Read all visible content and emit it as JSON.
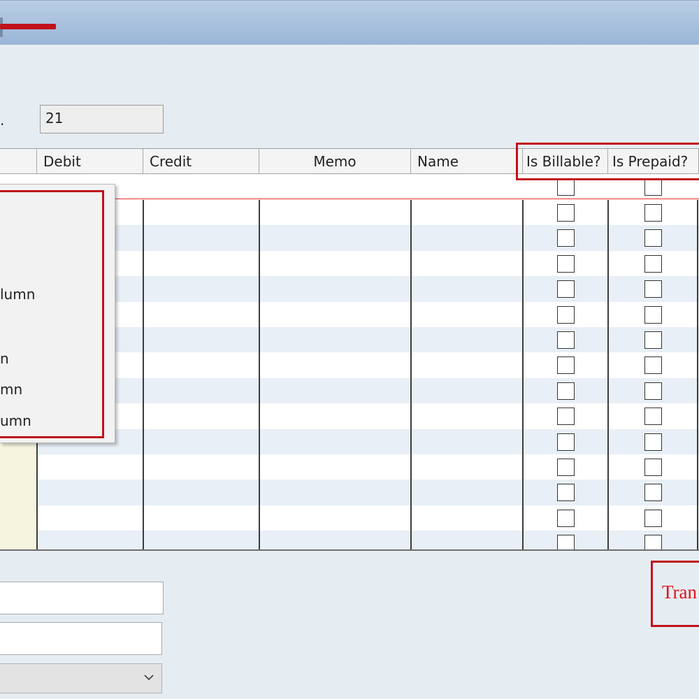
{
  "field": {
    "label_fragment": ".",
    "value": "21"
  },
  "grid": {
    "columns": [
      {
        "id": "debit",
        "label": "Debit"
      },
      {
        "id": "credit",
        "label": "Credit"
      },
      {
        "id": "memo",
        "label": "Memo"
      },
      {
        "id": "name",
        "label": "Name"
      },
      {
        "id": "is_billable",
        "label": "Is Billable?"
      },
      {
        "id": "is_prepaid",
        "label": "Is Prepaid?"
      }
    ]
  },
  "context_menu": {
    "items": [
      "lumn",
      "n",
      "mn",
      "umn"
    ]
  },
  "status_fragment": "Tran",
  "icons": {
    "dropdown": "chevron-down-icon",
    "checkbox": "checkbox-icon"
  },
  "colors": {
    "highlight": "#c0121b",
    "status_text": "#e01218",
    "row_alt": "#e8eff6",
    "first_col": "#f5f4df"
  }
}
